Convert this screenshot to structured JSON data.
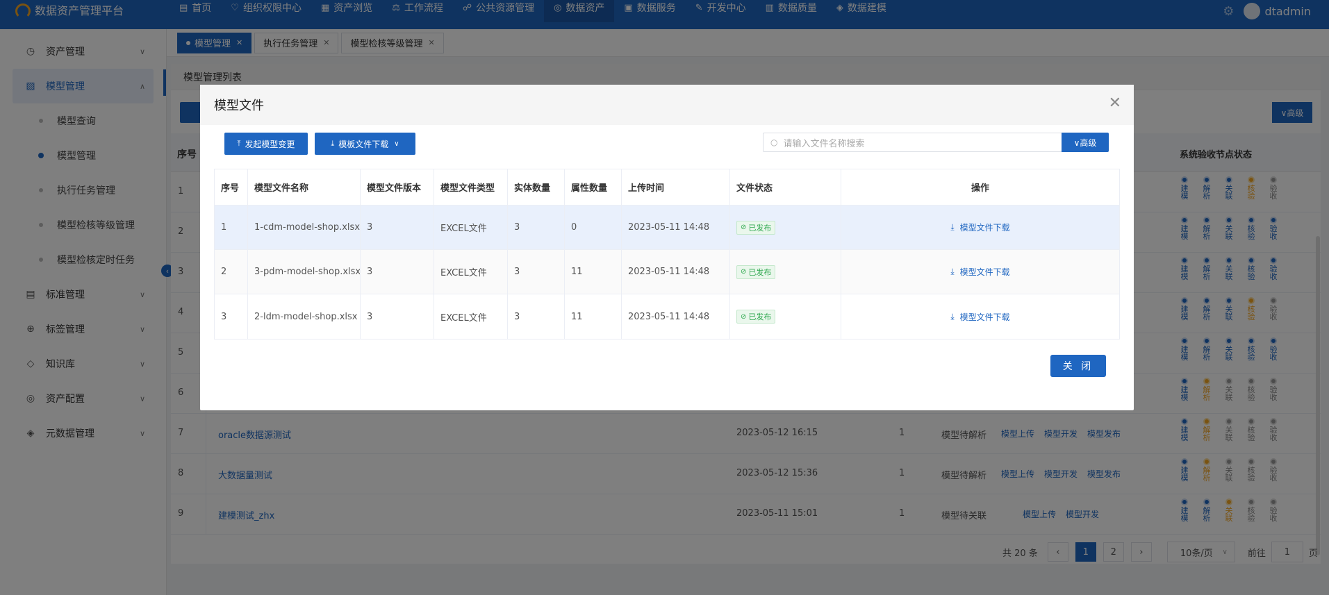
{
  "app": {
    "title": "数据资产管理平台"
  },
  "nav": [
    {
      "label": "首页",
      "icon": "home-icon",
      "glyph": "▤"
    },
    {
      "label": "组织权限中心",
      "icon": "heart-icon",
      "glyph": "♡"
    },
    {
      "label": "资产浏览",
      "icon": "grid-icon",
      "glyph": "▦"
    },
    {
      "label": "工作流程",
      "icon": "flow-icon",
      "glyph": "⚖"
    },
    {
      "label": "公共资源管理",
      "icon": "people-icon",
      "glyph": "☍"
    },
    {
      "label": "数据资产",
      "icon": "asset-icon",
      "glyph": "◎"
    },
    {
      "label": "数据服务",
      "icon": "service-icon",
      "glyph": "▣"
    },
    {
      "label": "开发中心",
      "icon": "edit-icon",
      "glyph": "✎"
    },
    {
      "label": "数据质量",
      "icon": "chart-icon",
      "glyph": "▥"
    },
    {
      "label": "数据建模",
      "icon": "layers-icon",
      "glyph": "◈"
    }
  ],
  "user": {
    "name": "dtadmin"
  },
  "sidebar": {
    "items": [
      {
        "label": "资产管理",
        "icon": "clock-icon",
        "glyph": "◷"
      },
      {
        "label": "模型管理",
        "icon": "model-icon",
        "glyph": "▨"
      },
      {
        "label": "标准管理",
        "icon": "doc-icon",
        "glyph": "▤"
      },
      {
        "label": "标签管理",
        "icon": "tag-plus-icon",
        "glyph": "⊕"
      },
      {
        "label": "知识库",
        "icon": "knowledge-icon",
        "glyph": "◇"
      },
      {
        "label": "资产配置",
        "icon": "config-icon",
        "glyph": "◎"
      },
      {
        "label": "元数据管理",
        "icon": "metadata-icon",
        "glyph": "◈"
      }
    ],
    "sub": [
      "模型查询",
      "模型管理",
      "执行任务管理",
      "模型检核等级管理",
      "模型检核定时任务"
    ]
  },
  "tabs": [
    "模型管理",
    "执行任务管理",
    "模型检核等级管理"
  ],
  "list": {
    "title": "模型管理列表",
    "adv_label": "∨高级",
    "col_no": "序号",
    "col_nodes": "系统验收节点状态",
    "node_labels": [
      "建模",
      "解析",
      "关联",
      "核验",
      "验收"
    ],
    "rows": [
      {
        "no": "1",
        "nodes": [
          "b",
          "b",
          "b",
          "o",
          "g"
        ]
      },
      {
        "no": "2",
        "nodes": [
          "b",
          "b",
          "b",
          "b",
          "b"
        ]
      },
      {
        "no": "3",
        "nodes": [
          "b",
          "b",
          "b",
          "b",
          "b"
        ]
      },
      {
        "no": "4",
        "nodes": [
          "b",
          "b",
          "b",
          "o",
          "g"
        ]
      },
      {
        "no": "5",
        "nodes": [
          "b",
          "b",
          "b",
          "b",
          "b"
        ]
      },
      {
        "no": "6",
        "nodes": [
          "b",
          "o",
          "g",
          "g",
          "g"
        ]
      },
      {
        "no": "7",
        "name": "oracle数据源测试",
        "date": "2023-05-12 16:15",
        "count": "1",
        "status": "模型待解析",
        "ops": [
          "模型上传",
          "模型开发",
          "模型发布"
        ],
        "nodes": [
          "b",
          "o",
          "g",
          "g",
          "g"
        ]
      },
      {
        "no": "8",
        "name": "大数据量测试",
        "date": "2023-05-12 15:36",
        "count": "1",
        "status": "模型待解析",
        "ops": [
          "模型上传",
          "模型开发",
          "模型发布"
        ],
        "nodes": [
          "b",
          "o",
          "g",
          "g",
          "g"
        ]
      },
      {
        "no": "9",
        "name": "建模测试_zhx",
        "date": "2023-05-11 15:01",
        "count": "1",
        "status": "模型待关联",
        "ops": [
          "模型上传",
          "模型开发"
        ],
        "nodes": [
          "b",
          "b",
          "o",
          "g",
          "g"
        ]
      }
    ]
  },
  "pager": {
    "total": "共 20 条",
    "pages": [
      "1",
      "2"
    ],
    "size": "10条/页",
    "goto": "前往",
    "page_value": "1",
    "page_suffix": "页"
  },
  "modal": {
    "title": "模型文件",
    "btn_change": "发起模型变更",
    "btn_template": "模板文件下载",
    "search_placeholder": "请输入文件名称搜索",
    "adv_label": "∨高级",
    "headers": [
      "序号",
      "模型文件名称",
      "模型文件版本",
      "模型文件类型",
      "实体数量",
      "属性数量",
      "上传时间",
      "文件状态",
      "操作"
    ],
    "rows": [
      {
        "no": "1",
        "name": "1-cdm-model-shop.xlsx",
        "version": "3",
        "type": "EXCEL文件",
        "entities": "3",
        "attrs": "0",
        "time": "2023-05-11 14:48",
        "status": "已发布",
        "op": "模型文件下载"
      },
      {
        "no": "2",
        "name": "3-pdm-model-shop.xlsx",
        "version": "3",
        "type": "EXCEL文件",
        "entities": "3",
        "attrs": "11",
        "time": "2023-05-11 14:48",
        "status": "已发布",
        "op": "模型文件下载"
      },
      {
        "no": "3",
        "name": "2-ldm-model-shop.xlsx",
        "version": "3",
        "type": "EXCEL文件",
        "entities": "3",
        "attrs": "11",
        "time": "2023-05-11 14:48",
        "status": "已发布",
        "op": "模型文件下载"
      }
    ],
    "close_label": "关 闭"
  }
}
